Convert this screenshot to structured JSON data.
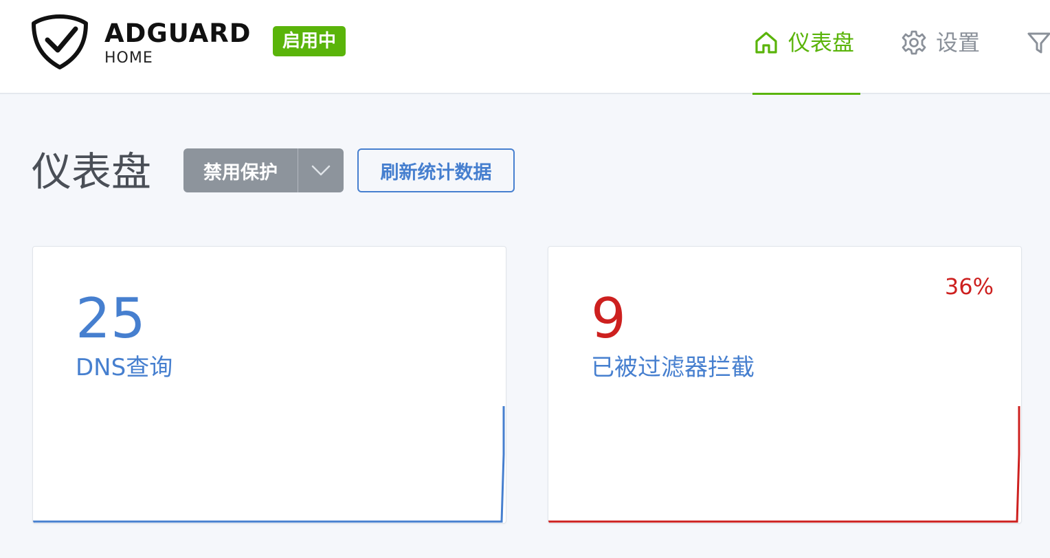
{
  "brand": {
    "name": "ADGUARD",
    "sub": "HOME",
    "status": "启用中"
  },
  "nav": {
    "dashboard": "仪表盘",
    "settings": "设置"
  },
  "page": {
    "title": "仪表盘",
    "disable_button": "禁用保护",
    "refresh_button": "刷新统计数据"
  },
  "cards": {
    "dns": {
      "value": "25",
      "label": "DNS查询",
      "color": "#467fcf"
    },
    "blocked": {
      "value": "9",
      "label": "已被过滤器拦截",
      "percent": "36%",
      "color": "#cd201f"
    }
  },
  "colors": {
    "accent": "#5ab40a",
    "blue": "#467fcf",
    "red": "#cd201f"
  },
  "icons": [
    "adguard-shield-icon",
    "home-icon",
    "gear-icon",
    "filter-icon",
    "chevron-down-icon"
  ]
}
